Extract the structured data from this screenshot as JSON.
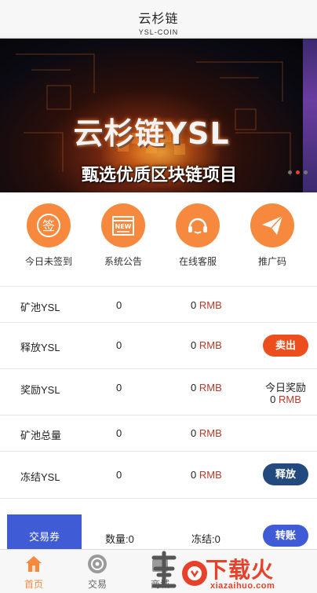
{
  "header": {
    "title": "云杉链",
    "subtitle": "YSL-COIN"
  },
  "banner": {
    "headline": "云杉链YSL",
    "tagline": "甄选优质区块链项目",
    "slide_count": 3,
    "active_slide": 2
  },
  "quick_entries": [
    {
      "label": "今日未签到",
      "icon": "sign-in-icon",
      "icon_text": "签"
    },
    {
      "label": "系统公告",
      "icon": "announcement-icon",
      "icon_text": "NEW"
    },
    {
      "label": "在线客服",
      "icon": "headset-icon"
    },
    {
      "label": "推广码",
      "icon": "paper-plane-icon"
    }
  ],
  "rows": {
    "pool": {
      "name": "矿池YSL",
      "qty": "0",
      "rmb": "0",
      "unit": "RMB"
    },
    "release": {
      "name": "释放YSL",
      "qty": "0",
      "rmb": "0",
      "unit": "RMB",
      "button": "卖出"
    },
    "reward": {
      "name": "奖励YSL",
      "qty": "0",
      "rmb": "0",
      "unit": "RMB",
      "today_label": "今日奖励",
      "today_value": "0",
      "today_unit": "RMB"
    },
    "pool_total": {
      "name": "矿池总量",
      "qty": "0",
      "rmb": "0",
      "unit": "RMB"
    },
    "frozen": {
      "name": "冻结YSL",
      "qty": "0",
      "rmb": "0",
      "unit": "RMB",
      "button": "释放"
    }
  },
  "voucher": {
    "label": "交易券",
    "qty": "数量:0",
    "frozen": "冻结:0",
    "button": "转账"
  },
  "tabs": [
    {
      "label": "首页",
      "icon": "home-icon",
      "active": true
    },
    {
      "label": "交易",
      "icon": "exchange-icon",
      "active": false
    },
    {
      "label": "商城",
      "icon": "store-icon",
      "active": false
    }
  ],
  "watermark": {
    "text": "下载火",
    "sub": "xiazaihuo.com"
  },
  "colors": {
    "accent": "#f6893d",
    "sell": "#ec4f1d",
    "release": "#234a7f",
    "voucher": "#3f5bd6",
    "rmb_unit": "#b53b2b"
  }
}
